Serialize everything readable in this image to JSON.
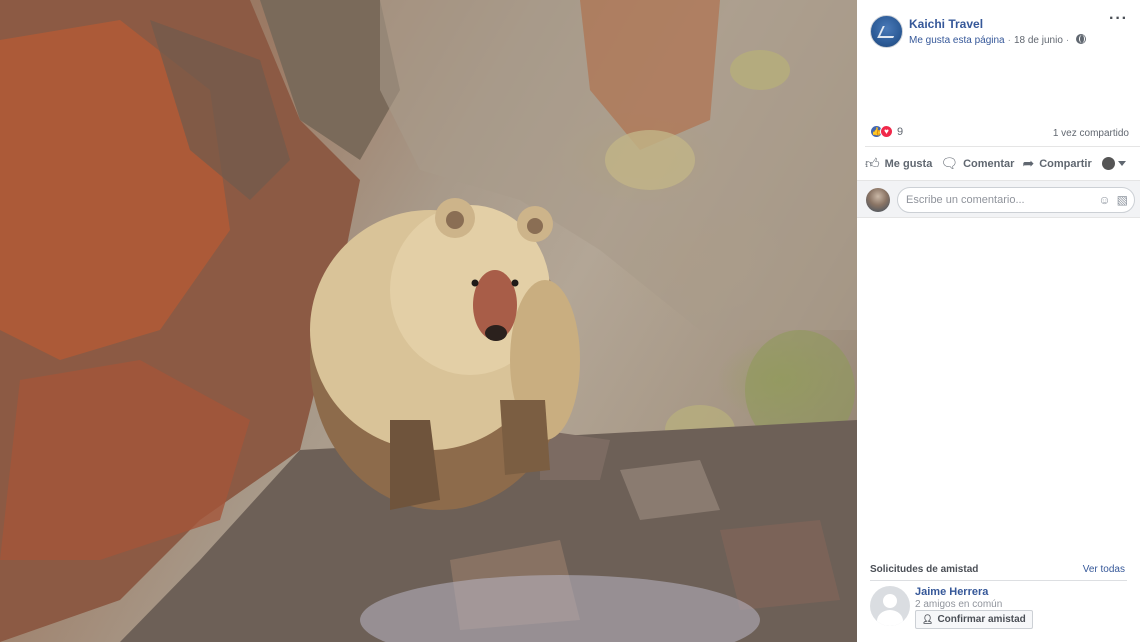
{
  "photo": {
    "subject": "bear-on-rocky-hillside"
  },
  "post": {
    "page_name": "Kaichi Travel",
    "page_like_text": "Me gusta esta página",
    "date": "18 de junio",
    "more_icon": "ellipsis-icon",
    "privacy_icon": "globe-icon",
    "reaction_count": "9",
    "shares_text": "1 vez compartido",
    "actions": {
      "like": "Me gusta",
      "comment": "Comentar",
      "share": "Compartir"
    },
    "comment_placeholder": "Escribe un comentario..."
  },
  "friend_requests": {
    "title": "Solicitudes de amistad",
    "see_all": "Ver todas",
    "items": [
      {
        "name": "Jaime Herrera",
        "mutual": "2 amigos en común",
        "confirm_label": "Confirmar amistad"
      }
    ]
  },
  "colors": {
    "link": "#365899",
    "like_blue": "#4267b2",
    "love_red": "#f0284a",
    "secondary_text": "#616770"
  }
}
